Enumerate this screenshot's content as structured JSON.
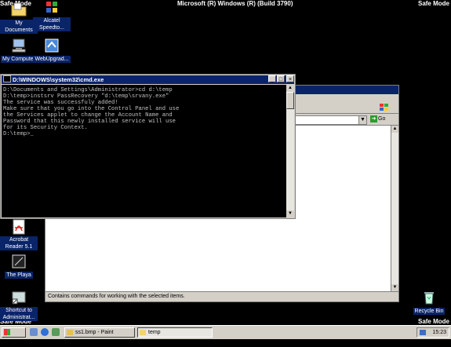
{
  "safe_mode": {
    "label": "Safe Mode"
  },
  "os_title": "Microsoft (R) Windows (R) (Build 3790)",
  "desktop_icons": [
    {
      "label": "My Documents"
    },
    {
      "label": "Alcatel Speedto..."
    },
    {
      "label": "My Computer"
    },
    {
      "label": "WebUpgrad..."
    },
    {
      "label": "Acrobat Reader 5.1"
    },
    {
      "label": "The Playa"
    },
    {
      "label": "Shortcut to Administrat..."
    },
    {
      "label": "Recycle Bin"
    }
  ],
  "cmd": {
    "title": "D:\\WINDOWS\\system32\\cmd.exe",
    "lines": [
      "D:\\Documents and Settings\\Administrator>cd d:\\temp",
      "",
      "D:\\temp>instsrv PassRecovery \"d:\\temp\\srvany.exe\"",
      "",
      "The service was successfuly added!",
      "",
      "Make sure that you go into the Control Panel and use",
      "the Services applet to change the Account Name and",
      "Password that this newly installed service will use",
      "for its Security Context.",
      "",
      "D:\\temp>_"
    ],
    "buttons": {
      "minimize": "_",
      "maximize": "□",
      "close": "×"
    }
  },
  "explorer": {
    "go_label": "Go",
    "status_text": "Contains commands for working with the selected items."
  },
  "taskbar": {
    "start_label": "Start",
    "tasks": [
      {
        "label": "ss1.bmp - Paint",
        "active": false
      },
      {
        "label": "temp",
        "active": true
      }
    ],
    "clock": "15:23"
  },
  "colors": {
    "desktop": "#000000",
    "titlebar_active": "#0a246a",
    "window_face": "#d4d0c8"
  }
}
